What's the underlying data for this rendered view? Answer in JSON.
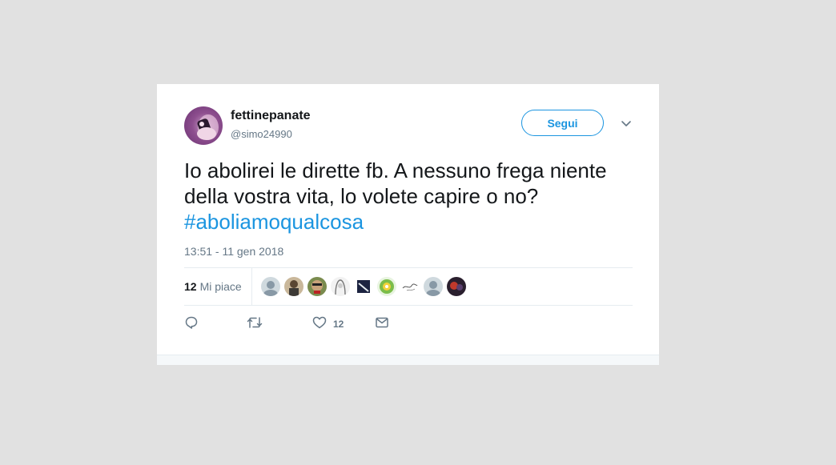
{
  "tweet": {
    "display_name": "fettinepanate",
    "handle": "@simo24990",
    "follow_label": "Segui",
    "text": "Io abolirei le dirette fb. A nessuno frega niente della vostra vita, lo volete capire o no?",
    "hashtag": "#aboliamoqualcosa",
    "timestamp": "13:51 - 11 gen 2018",
    "likes_count": "12",
    "likes_label": "Mi piace",
    "like_action_count": "12"
  },
  "colors": {
    "accent": "#1b95e0",
    "secondary_text": "#657786",
    "primary_text": "#14171a",
    "page_background": "#e1e1e1"
  },
  "icons": {
    "reply": "reply-icon",
    "retweet": "retweet-icon",
    "like": "heart-icon",
    "dm": "envelope-icon",
    "caret": "chevron-down-icon"
  }
}
